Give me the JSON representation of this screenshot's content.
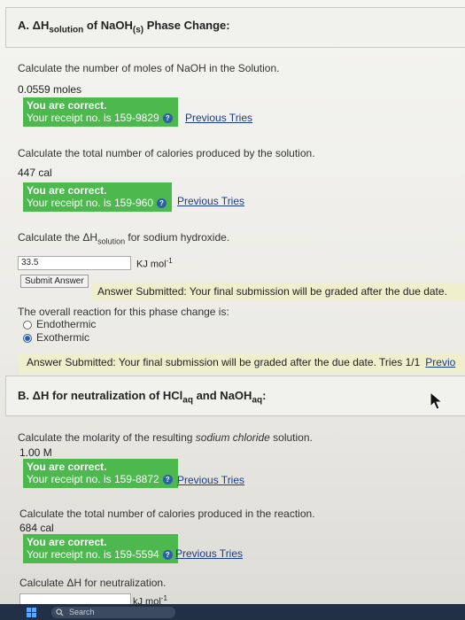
{
  "sectionA": {
    "title": "A. ΔH",
    "title_sub": "solution",
    "title_mid": " of NaOH",
    "title_sub2": "(s)",
    "title_end": " Phase Change:",
    "q1": "Calculate the number of moles of NaOH in the Solution.",
    "a1": "0.0559 moles",
    "c1_line1": "You are correct.",
    "c1_line2": "Your receipt no. is 159-9829",
    "prev": "Previous Tries",
    "q2": "Calculate the total number of calories produced by the solution.",
    "a2": "447 cal",
    "c2_line1": "You are correct.",
    "c2_line2": "Your receipt no. is 159-960",
    "q3_pre": "Calculate the ΔH",
    "q3_sub": "solution",
    "q3_post": " for sodium hydroxide.",
    "input_value": "33.5",
    "unit": "KJ mol",
    "unit_sup": "-1",
    "submit_label": "Submit Answer",
    "submitted_msg": "Answer Submitted: Your final submission will be graded after the due date.",
    "q4": "The overall reaction for this phase change is:",
    "opt1": "Endothermic",
    "opt2": "Exothermic",
    "submitted_msg2": "Answer Submitted: Your final submission will be graded after the due date.  Tries 1/1",
    "previo": "Previo"
  },
  "sectionB": {
    "title": "B. ΔH for neutralization of HCl",
    "title_sub": "aq",
    "title_mid": " and NaOH",
    "title_sub2": "aq",
    "title_end": ":",
    "q1_pre": "Calculate the molarity of the resulting ",
    "q1_em": "sodium chloride",
    "q1_post": " solution.",
    "a1": "1.00 M",
    "c1_line1": "You are correct.",
    "c1_line2": "Your receipt no. is 159-8872",
    "prev": "Previous Tries",
    "q2": "Calculate the total number of calories produced in the reaction.",
    "a2": "684 cal",
    "c2_line1": "You are correct.",
    "c2_line2": "Your receipt no. is 159-5594",
    "q3": "Calculate ΔH for neutralization.",
    "unit": "kJ mol",
    "unit_sup": "-1"
  },
  "taskbar": {
    "search_placeholder": "Search"
  },
  "colors": {
    "correct_green": "#4db84d",
    "submitted_yellow": "#efefcd",
    "link_blue": "#1a3a8a"
  }
}
